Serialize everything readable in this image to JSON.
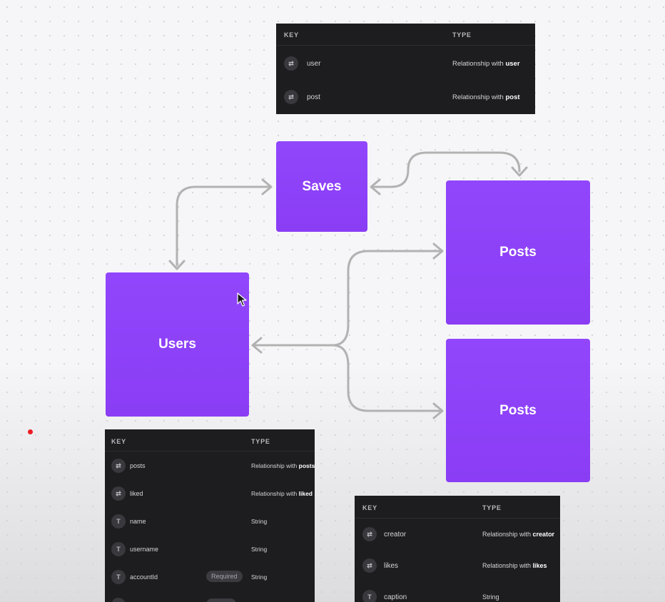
{
  "colors": {
    "node_purple": "#8f43fb",
    "connector_gray": "#b2b2b2",
    "table_bg": "#1d1d20",
    "marker_red": "#ee1c24"
  },
  "nodes": {
    "saves": "Saves",
    "users": "Users",
    "posts_top": "Posts",
    "posts_bottom": "Posts"
  },
  "saves_table": {
    "key_header": "KEY",
    "type_header": "TYPE",
    "rows": [
      {
        "icon": "relationship-icon",
        "glyph": "⇄",
        "key": "user",
        "type_prefix": "Relationship with ",
        "type_target": "user"
      },
      {
        "icon": "relationship-icon",
        "glyph": "⇄",
        "key": "post",
        "type_prefix": "Relationship with ",
        "type_target": "post"
      }
    ]
  },
  "users_table": {
    "key_header": "KEY",
    "type_header": "TYPE",
    "rows": [
      {
        "icon": "relationship-icon",
        "glyph": "⇄",
        "key": "posts",
        "type_prefix": "Relationship with ",
        "type_target": "posts"
      },
      {
        "icon": "relationship-icon",
        "glyph": "⇄",
        "key": "liked",
        "type_prefix": "Relationship with ",
        "type_target": "liked"
      },
      {
        "icon": "text-type-icon",
        "glyph": "T",
        "key": "name",
        "type_prefix": "String"
      },
      {
        "icon": "text-type-icon",
        "glyph": "T",
        "key": "username",
        "type_prefix": "String"
      },
      {
        "icon": "text-type-icon",
        "glyph": "T",
        "key": "accountId",
        "badge": "Required",
        "type_prefix": "String"
      }
    ]
  },
  "posts_table": {
    "key_header": "KEY",
    "type_header": "TYPE",
    "rows": [
      {
        "icon": "relationship-icon",
        "glyph": "⇄",
        "key": "creator",
        "type_prefix": "Relationship with ",
        "type_target": "creator"
      },
      {
        "icon": "relationship-icon",
        "glyph": "⇄",
        "key": "likes",
        "type_prefix": "Relationship with ",
        "type_target": "likes"
      },
      {
        "icon": "text-type-icon",
        "glyph": "T",
        "key": "caption",
        "type_prefix": "String"
      }
    ]
  }
}
